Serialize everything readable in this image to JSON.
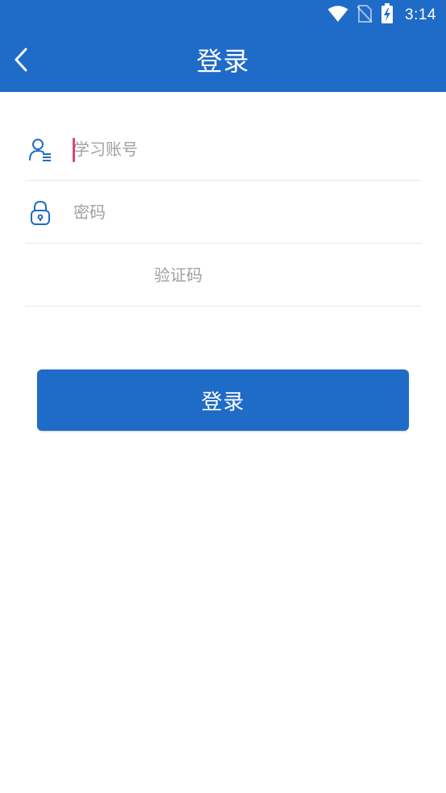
{
  "status_bar": {
    "time": "3:14",
    "icons": [
      "wifi-icon",
      "no-sim-icon",
      "battery-charging-icon"
    ]
  },
  "app_bar": {
    "title": "登录",
    "back_icon": "chevron-left-icon"
  },
  "form": {
    "account": {
      "placeholder": "学习账号",
      "value": "",
      "icon": "user-list-icon"
    },
    "password": {
      "placeholder": "密码",
      "value": "",
      "icon": "lock-icon"
    },
    "captcha": {
      "placeholder": "验证码",
      "value": ""
    }
  },
  "login_button": {
    "label": "登录"
  },
  "colors": {
    "primary": "#1f6bc8",
    "caret": "#e0407a",
    "placeholder": "#a0a0a0",
    "divider": "#e6e6e6"
  }
}
